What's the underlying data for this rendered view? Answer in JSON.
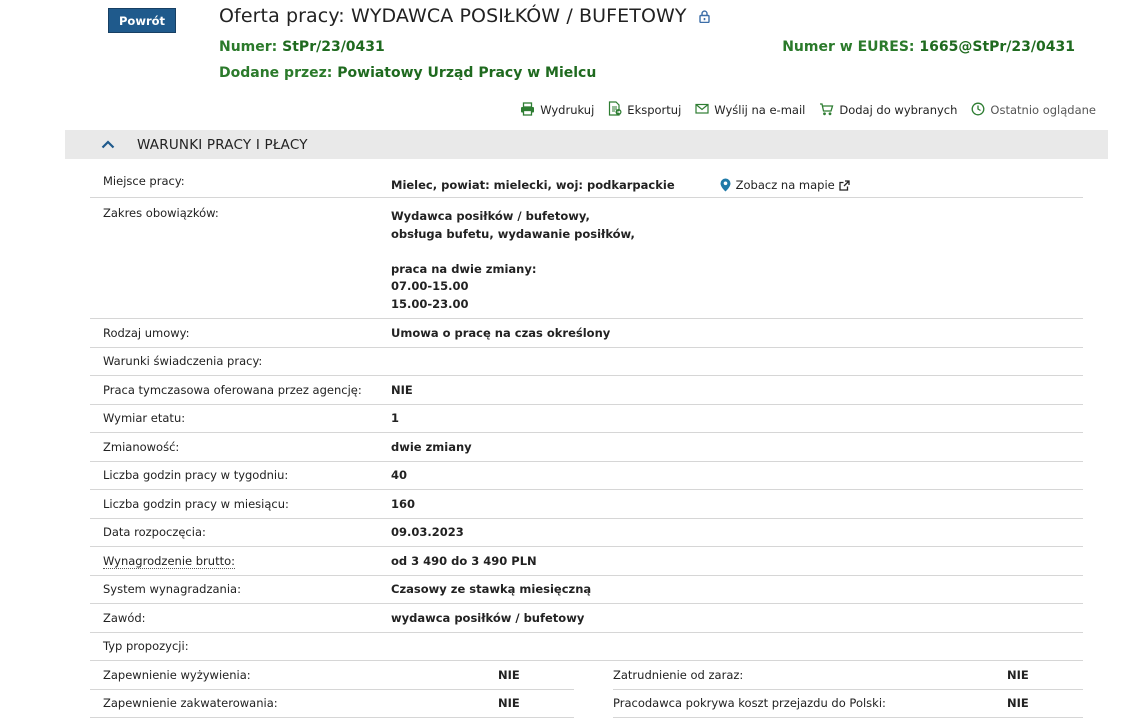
{
  "back_button": {
    "label": "Powrót"
  },
  "header": {
    "title": "Oferta pracy: WYDAWCA POSIŁKÓW / BUFETOWY",
    "number_label": "Numer:",
    "number_value": "StPr/23/0431",
    "eures_label": "Numer w EURES:",
    "eures_value": "1665@StPr/23/0431",
    "added_label": "Dodane przez:",
    "added_value": "Powiatowy Urząd Pracy w Mielcu"
  },
  "actions": [
    {
      "label": "Wydrukuj",
      "icon": "printer-icon"
    },
    {
      "label": "Eksportuj",
      "icon": "export-icon"
    },
    {
      "label": "Wyślij na e-mail",
      "icon": "mail-icon"
    },
    {
      "label": "Dodaj do wybranych",
      "icon": "cart-icon"
    },
    {
      "label": "Ostatnio oglądane",
      "icon": "clock-icon"
    }
  ],
  "section": {
    "title": "WARUNKI PRACY I PŁACY",
    "place": {
      "label": "Miejsce pracy:",
      "value": "Mielec, powiat: mielecki, woj: podkarpackie",
      "map_link": "Zobacz na mapie"
    },
    "duties": {
      "label": "Zakres obowiązków:",
      "lines": [
        "Wydawca posiłków / bufetowy,",
        "obsługa bufetu, wydawanie posiłków,",
        "",
        "praca na dwie zmiany:",
        "07.00-15.00",
        "15.00-23.00"
      ]
    },
    "rows": [
      {
        "label": "Rodzaj umowy:",
        "value": "Umowa o pracę na czas określony"
      },
      {
        "label": "Warunki świadczenia pracy:",
        "value": ""
      },
      {
        "label": "Praca tymczasowa oferowana przez agencję:",
        "value": "NIE"
      },
      {
        "label": "Wymiar etatu:",
        "value": "1"
      },
      {
        "label": "Zmianowość:",
        "value": "dwie zmiany"
      },
      {
        "label": "Liczba godzin pracy w tygodniu:",
        "value": "40"
      },
      {
        "label": "Liczba godzin pracy w miesiącu:",
        "value": "160"
      },
      {
        "label": "Data rozpoczęcia:",
        "value": "09.03.2023"
      },
      {
        "label": "Wynagrodzenie brutto:",
        "value": "od 3 490 do 3 490 PLN"
      },
      {
        "label": "System wynagradzania:",
        "value": "Czasowy ze stawką miesięczną"
      },
      {
        "label": "Zawód:",
        "value": "wydawca posiłków / bufetowy"
      },
      {
        "label": "Typ propozycji:",
        "value": ""
      }
    ],
    "split_rows": [
      {
        "left_label": "Zapewnienie wyżywienia:",
        "left_value": "NIE",
        "right_label": "Zatrudnienie od zaraz:",
        "right_value": "NIE"
      },
      {
        "left_label": "Zapewnienie zakwaterowania:",
        "left_value": "NIE",
        "right_label": "Pracodawca pokrywa koszt przejazdu do Polski:",
        "right_value": "NIE"
      }
    ]
  },
  "colors": {
    "primary_button": "#1f5a8c",
    "meta_green": "#2b7a2b",
    "section_bg": "#e9e9e9",
    "icon_green": "#2e7d32"
  }
}
